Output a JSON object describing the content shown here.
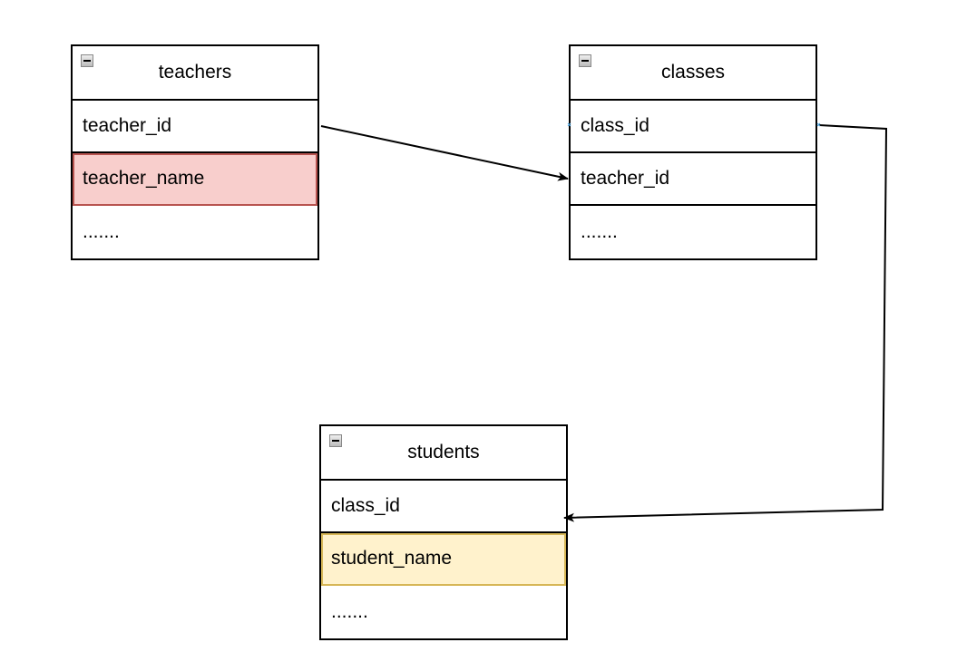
{
  "tables": [
    {
      "title": "teachers",
      "rows": [
        {
          "label": "teacher_id",
          "highlight": ""
        },
        {
          "label": "teacher_name",
          "highlight": "pink"
        },
        {
          "label": ".......",
          "highlight": ""
        }
      ]
    },
    {
      "title": "classes",
      "rows": [
        {
          "label": "class_id",
          "highlight": ""
        },
        {
          "label": "teacher_id",
          "highlight": ""
        },
        {
          "label": ".......",
          "highlight": ""
        }
      ]
    },
    {
      "title": "students",
      "rows": [
        {
          "label": "class_id",
          "highlight": ""
        },
        {
          "label": "student_name",
          "highlight": "yellow"
        },
        {
          "label": ".......",
          "highlight": ""
        }
      ]
    }
  ],
  "colors": {
    "pink_fill": "#f8cecc",
    "pink_border": "#b85450",
    "yellow_fill": "#fff2cc",
    "yellow_border": "#d6b656"
  },
  "edges": [
    {
      "from": "teachers.teacher_id",
      "to": "classes.teacher_id"
    },
    {
      "from": "classes.class_id",
      "to": "students.class_id"
    }
  ]
}
